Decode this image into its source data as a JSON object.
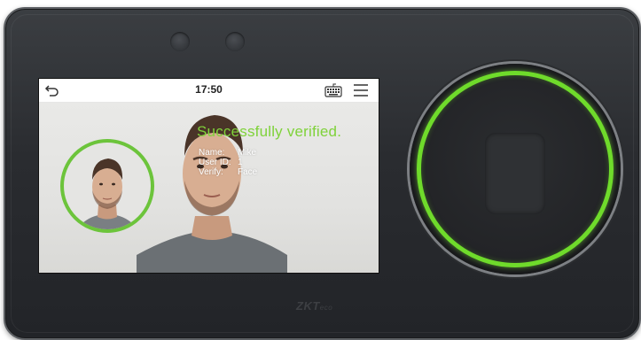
{
  "status_bar": {
    "time": "17:50",
    "icons": [
      "back-arrow-icon",
      "keyboard-icon",
      "menu-icon"
    ]
  },
  "verification": {
    "message": "Successfully verified.",
    "fields": [
      {
        "label": "Name:",
        "value": "Mike"
      },
      {
        "label": "User ID:",
        "value": "1"
      },
      {
        "label": "Verify:",
        "value": "Face"
      }
    ]
  },
  "branding": {
    "logo_main": "ZKT",
    "logo_sub": "eco"
  },
  "colors": {
    "success_green": "#7fd23a",
    "ring_green": "#6fdb2b",
    "avatar_ring": "#6cc43b",
    "device_body": "#2a2c30"
  }
}
